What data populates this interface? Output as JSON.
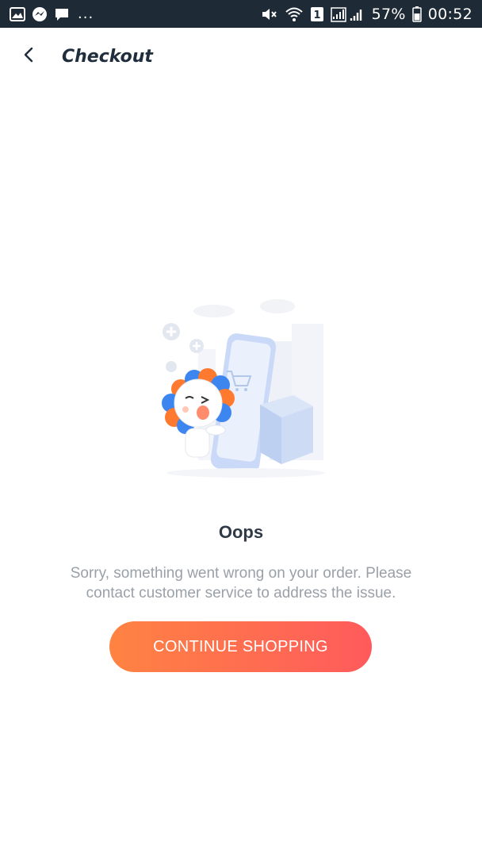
{
  "status_bar": {
    "battery_text": "57%",
    "time": "00:52",
    "sim_slot": "1",
    "overflow_dots": "...",
    "icons": [
      "gallery-icon",
      "messenger-icon",
      "chat-icon",
      "mute-icon",
      "wifi-icon",
      "signal-icon",
      "battery-icon"
    ]
  },
  "header": {
    "back_icon": "chevron-left-icon",
    "title": "Checkout"
  },
  "error": {
    "illustration": "lion-mascot-with-phone-and-cart",
    "title": "Oops",
    "message": "Sorry, something went wrong on your order. Please contact customer service to address the issue."
  },
  "actions": {
    "continue_label": "CONTINUE SHOPPING"
  },
  "colors": {
    "status_bar_bg": "#1e2a36",
    "button_gradient_start": "#ff8342",
    "button_gradient_end": "#ff5a5c",
    "title_text": "#2f3a46",
    "body_text": "#9aa0a8"
  }
}
